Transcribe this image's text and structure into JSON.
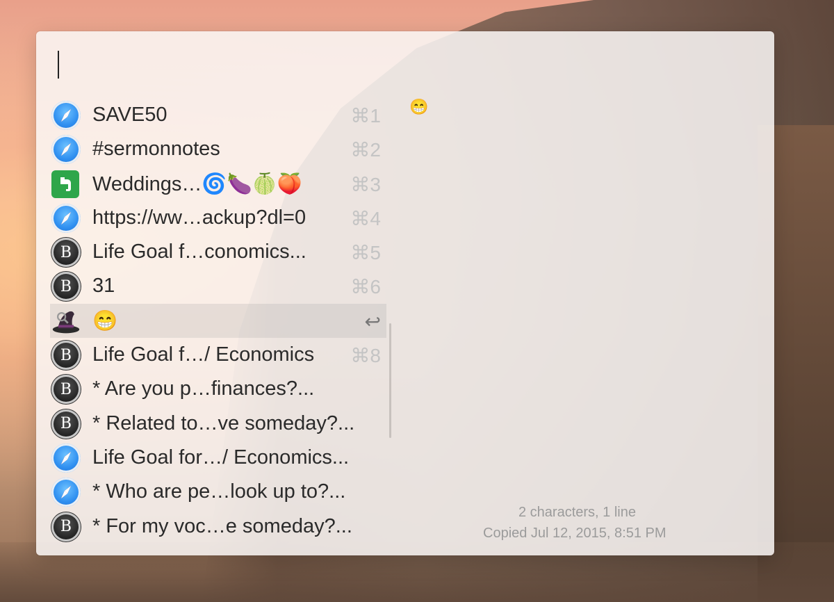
{
  "search": {
    "value": "",
    "placeholder": ""
  },
  "items": [
    {
      "icon": "safari-icon",
      "label": "SAVE50",
      "shortcut": "⌘1",
      "selected": false
    },
    {
      "icon": "safari-icon",
      "label": "#sermonnotes",
      "shortcut": "⌘2",
      "selected": false
    },
    {
      "icon": "evernote-icon",
      "label": "Weddings…🌀🍆🍈🍑",
      "shortcut": "⌘3",
      "selected": false
    },
    {
      "icon": "safari-icon",
      "label": "https://ww…ackup?dl=0",
      "shortcut": "⌘4",
      "selected": false
    },
    {
      "icon": "bbedit-icon",
      "label": "Life Goal f…conomics...",
      "shortcut": "⌘5",
      "selected": false
    },
    {
      "icon": "bbedit-icon",
      "label": "31",
      "shortcut": "⌘6",
      "selected": false
    },
    {
      "icon": "alfred-icon",
      "label": "😁",
      "shortcut": "↩",
      "selected": true
    },
    {
      "icon": "bbedit-icon",
      "label": "Life Goal f…/ Economics",
      "shortcut": "⌘8",
      "selected": false
    },
    {
      "icon": "bbedit-icon",
      "label": "* Are you p…finances?...",
      "shortcut": "",
      "selected": false
    },
    {
      "icon": "bbedit-icon",
      "label": "* Related to…ve someday?...",
      "shortcut": "",
      "selected": false
    },
    {
      "icon": "safari-icon",
      "label": "Life Goal for…/ Economics...",
      "shortcut": "",
      "selected": false
    },
    {
      "icon": "safari-icon",
      "label": "* Who are pe…look up to?...",
      "shortcut": "",
      "selected": false
    },
    {
      "icon": "bbedit-icon",
      "label": "* For my voc…e someday?...",
      "shortcut": "",
      "selected": false
    }
  ],
  "preview": {
    "content": "😁",
    "characters": "2 characters, 1 line",
    "copied": "Copied Jul 12, 2015, 8:51 PM"
  },
  "colors": {
    "selection": "#d9d7d6",
    "accent": "#2f8ff0"
  }
}
